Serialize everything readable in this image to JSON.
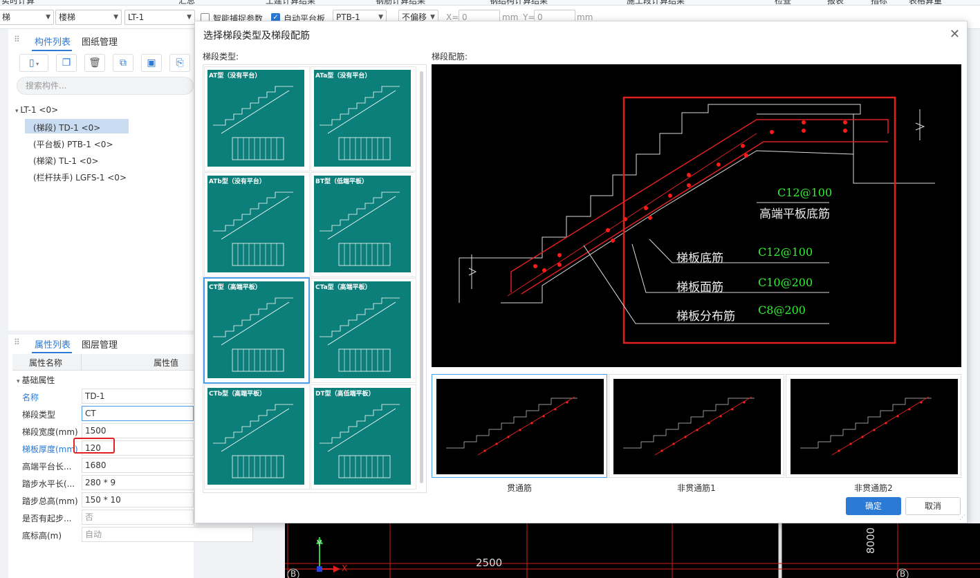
{
  "menubar": {
    "items": [
      "实时计算",
      "汇总",
      "土建计算结果",
      "钢筋计算结果",
      "钢结构计算结果",
      "施工段计算结果",
      "检查",
      "报表",
      "指标",
      "表格算量"
    ]
  },
  "toolbar": {
    "sel1": "梯",
    "sel2": "楼梯",
    "sel3": "LT-1",
    "chk_smart_label": "智能捕捉参数",
    "chk_auto_label": "自动平台板",
    "sel4": "PTB-1",
    "sel5": "不偏移",
    "x_label": "X=",
    "x_value": "0",
    "x_unit": "mm",
    "y_label": "Y=",
    "y_value": "0",
    "y_unit": "mm"
  },
  "left": {
    "tab_list": "构件列表",
    "tab_drawing": "图纸管理",
    "search_placeholder": "搜索构件...",
    "tree": [
      {
        "label": "LT-1 <0>"
      },
      {
        "label": "(梯段) TD-1 <0>"
      },
      {
        "label": "(平台板) PTB-1 <0>"
      },
      {
        "label": "(梯梁) TL-1 <0>"
      },
      {
        "label": "(栏杆扶手) LGFS-1 <0>"
      }
    ],
    "tab_props": "属性列表",
    "tab_layers": "图层管理",
    "col_name": "属性名称",
    "col_value": "属性值",
    "group": "基础属性",
    "props": [
      {
        "name": "名称",
        "value": "TD-1"
      },
      {
        "name": "梯段类型",
        "value": "CT"
      },
      {
        "name": "梯段宽度(mm)",
        "value": "1500"
      },
      {
        "name": "梯板厚度(mm)",
        "value": "120"
      },
      {
        "name": "高端平台长...",
        "value": "1680"
      },
      {
        "name": "踏步水平长(...",
        "value": "280 * 9"
      },
      {
        "name": "踏步总高(mm)",
        "value": "150 * 10"
      },
      {
        "name": "是否有起步...",
        "value": "否"
      },
      {
        "name": "底标高(m)",
        "value": "自动"
      }
    ]
  },
  "dialog": {
    "title": "选择梯段类型及梯段配筋",
    "type_label": "梯段类型:",
    "rebar_label": "梯段配筋:",
    "types": [
      {
        "caption": "AT型（没有平台）"
      },
      {
        "caption": "ATa型（没有平台）"
      },
      {
        "caption": "ATb型（没有平台）"
      },
      {
        "caption": "BT型（低端平板）"
      },
      {
        "caption": "CT型（高端平板）"
      },
      {
        "caption": "CTa型（高端平板）"
      },
      {
        "caption": "CTb型（高端平板）"
      },
      {
        "caption": "DT型（高低端平板）"
      }
    ],
    "preview": {
      "c12_100_top": "C12@100",
      "high_end": "高端平板底筋",
      "bottom_label": "梯板底筋",
      "bottom_value": "C12@100",
      "face_label": "梯板面筋",
      "face_value": "C10@200",
      "dist_label": "梯板分布筋",
      "dist_value": "C8@200"
    },
    "variants": [
      {
        "label": "贯通筋"
      },
      {
        "label": "非贯通筋1"
      },
      {
        "label": "非贯通筋2"
      }
    ],
    "ok": "确定",
    "cancel": "取消"
  },
  "cad": {
    "dim1": "2500",
    "dim2": "8000",
    "axis_b": "B",
    "x_axis": "X",
    "y_axis": "Y"
  },
  "colors": {
    "accent": "#2a7ad6",
    "teal": "#0d7f7a",
    "red_box": "#e03030",
    "green_text": "#33ee33"
  }
}
